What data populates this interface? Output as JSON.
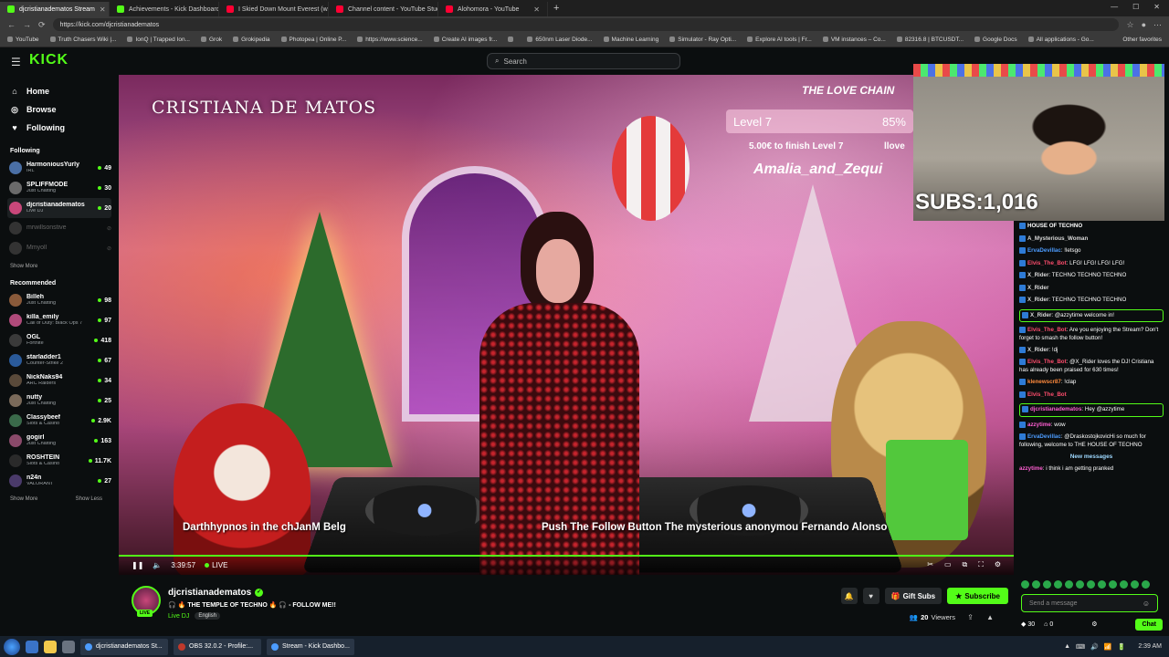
{
  "browser": {
    "tabs": [
      {
        "label": "djcristianadematos Stream",
        "active": true,
        "color": "#53fc18"
      },
      {
        "label": "Achievements - Kick Dashboard",
        "active": false,
        "color": "#53fc18"
      },
      {
        "label": "I Skied Down Mount Everest (w...",
        "active": false,
        "color": "#ff0033"
      },
      {
        "label": "Channel content - YouTube Studio",
        "active": false,
        "color": "#ff0033"
      },
      {
        "label": "Alohomora - YouTube",
        "active": false,
        "color": "#ff0033"
      }
    ],
    "url": "https://kick.com/djcristianadematos",
    "bookmarks": [
      "YouTube",
      "Truth Chasers Wiki |...",
      "IonQ | Trapped Ion...",
      "Grok",
      "Grokipedia",
      "Photopea | Online P...",
      "https://www.science...",
      "Create AI images fr...",
      "",
      "650nm Laser Diode...",
      "Machine Learning",
      "Simulator - Ray Opti...",
      "Explore AI tools | Fr...",
      "VM instances – Co...",
      "82316.8 | BTCUSDT...",
      "Google Docs",
      "All applications - Go..."
    ],
    "other_bookmarks": "Other favorites"
  },
  "kick": {
    "logo": "KICK",
    "search_placeholder": "Search",
    "nav": [
      {
        "label": "Home",
        "icon": "home-icon"
      },
      {
        "label": "Browse",
        "icon": "compass-icon"
      },
      {
        "label": "Following",
        "icon": "heart-icon"
      }
    ],
    "following_heading": "Following",
    "following": [
      {
        "name": "HarmoniousYurly",
        "category": "IRL",
        "viewers": "49",
        "color": "#4a6fa5"
      },
      {
        "name": "SPLIFFMODE",
        "category": "Just Chatting",
        "viewers": "30",
        "color": "#6a6a6a"
      },
      {
        "name": "djcristianadematos",
        "category": "Live DJ",
        "viewers": "20",
        "color": "#c9477a",
        "active": true
      },
      {
        "name": "mrwillsonstive",
        "category": "",
        "viewers": "",
        "color": "#333",
        "offline": true
      },
      {
        "name": "Mmyoll",
        "category": "",
        "viewers": "",
        "color": "#333",
        "offline": true
      }
    ],
    "show_more": "Show More",
    "recommended_heading": "Recommended",
    "recommended": [
      {
        "name": "Billeh",
        "category": "Just Chatting",
        "viewers": "98",
        "color": "#8a5a3a"
      },
      {
        "name": "killa_emily",
        "category": "Call of Duty: Black Ops 7",
        "viewers": "97",
        "color": "#b04a7a"
      },
      {
        "name": "OGL",
        "category": "Fortnite",
        "viewers": "418",
        "color": "#3a3a3a"
      },
      {
        "name": "starladder1",
        "category": "Counter-Strike 2",
        "viewers": "67",
        "color": "#2a5a9a"
      },
      {
        "name": "NickNaks94",
        "category": "ARC Raiders",
        "viewers": "34",
        "color": "#5a4a3a"
      },
      {
        "name": "nutty",
        "category": "Just Chatting",
        "viewers": "25",
        "color": "#7a6a5a"
      },
      {
        "name": "Classybeef",
        "category": "Slots & Casino",
        "viewers": "2.9K",
        "color": "#3a6a4a"
      },
      {
        "name": "gogirl",
        "category": "Just Chatting",
        "viewers": "163",
        "color": "#8a4a6a"
      },
      {
        "name": "ROSHTEIN",
        "category": "Slots & Casino",
        "viewers": "11.7K",
        "color": "#2a2a2a"
      },
      {
        "name": "n24n",
        "category": "VALORANT",
        "viewers": "27",
        "color": "#4a3a6a"
      }
    ],
    "show_more_2": "Show More",
    "show_less": "Show Less"
  },
  "video": {
    "overlay_name": "CRISTIANA DE MATOS",
    "love_title": "THE LOVE CHAIN",
    "level_label": "Level 7",
    "level_pct": "85%",
    "level_sub": "5.00€ to finish Level 7",
    "level_sub2": "llove",
    "supporter": "Amalia_and_Zequi",
    "ticker_left": "Darthhypnos in the chJanM Belg",
    "ticker_right": "Push The Follow Button The mysterious anonymou Fernando Alonso",
    "elapsed": "3:39:57",
    "live_label": "LIVE",
    "subs_label": "SUBS:1,016",
    "progress": 1.0
  },
  "chat": {
    "messages": [
      {
        "user": "HOUSE OF TECHNO",
        "text": "",
        "color": "#ffffff"
      },
      {
        "user": "A_Mysterious_Woman",
        "text": "",
        "color": "#d9d9d9"
      },
      {
        "user": "ErvaDevillac",
        "text": "!letsgo",
        "color": "#4c9cff"
      },
      {
        "user": "Elvis_The_Bot",
        "text": "LFG! LFG! LFG! LFG!",
        "color": "#ff4d6d"
      },
      {
        "user": "X_Rider",
        "text": "TECHNO TECHNO TECHNO",
        "color": "#d9d9d9"
      },
      {
        "user": "X_Rider",
        "text": "",
        "color": "#d9d9d9"
      },
      {
        "user": "X_Rider",
        "text": "TECHNO TECHNO TECHNO",
        "color": "#d9d9d9"
      },
      {
        "user": "X_Rider",
        "text": "@azzytime welcome in!",
        "color": "#d9d9d9",
        "highlight": true
      },
      {
        "user": "Elvis_The_Bot",
        "text": "Are you enjoying the Stream? Don't forget to smash the follow button!",
        "color": "#ff4d6d"
      },
      {
        "user": "X_Rider",
        "text": "!dj",
        "color": "#d9d9d9"
      },
      {
        "user": "Elvis_The_Bot",
        "text": "@X_Rider loves the DJ! Cristiana has already been praised for 630 times!",
        "color": "#ff4d6d"
      },
      {
        "user": "klenewscr87",
        "text": "!clap",
        "color": "#ff8a3d"
      },
      {
        "user": "Elvis_The_Bot",
        "text": "",
        "color": "#ff4d6d"
      },
      {
        "user": "djcristianadematos",
        "text": "Hey @azzytime",
        "color": "#ff5fd2",
        "highlight": true
      },
      {
        "user": "azzytime",
        "text": "wow",
        "color": "#ff5fd2"
      },
      {
        "user": "ErvaDevillac",
        "text": "@DraskostojkovicHi so much for following, welcome to THE HOUSE OF TECHNO",
        "color": "#4c9cff"
      }
    ],
    "new_messages": "New messages",
    "last_message": {
      "user": "azzytime",
      "text": "i think i am getting pranked",
      "color": "#ff5fd2"
    },
    "input_placeholder": "Send a message",
    "points": "30",
    "gifts": "0",
    "chat_button": "Chat"
  },
  "streaminfo": {
    "channel": "djcristianadematos",
    "title": "🎧 🔥 THE TEMPLE OF TECHNO 🔥 🎧 - FOLLOW ME!!",
    "category": "Live DJ",
    "language": "English",
    "live_badge": "LIVE",
    "gift_subs": "Gift Subs",
    "subscribe": "Subscribe",
    "viewers": "20",
    "viewers_label": "Viewers"
  },
  "taskbar": {
    "tasks": [
      {
        "label": "djcristianadematos St...",
        "color": "#4c9cff"
      },
      {
        "label": "OBS 32.0.2 - Profile:...",
        "color": "#c0392b"
      },
      {
        "label": "Stream - Kick Dashbo...",
        "color": "#4c9cff"
      }
    ],
    "time": "2:39 AM"
  }
}
